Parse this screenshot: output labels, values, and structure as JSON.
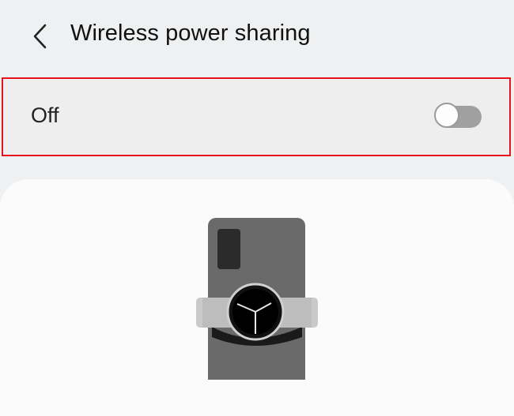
{
  "header": {
    "title": "Wireless power sharing",
    "back_icon": "chevron-left-icon"
  },
  "toggle": {
    "label": "Off",
    "state": "off"
  },
  "illustration": {
    "name": "phone-with-watch-illustration"
  },
  "colors": {
    "background": "#eef0f1",
    "highlight_border": "#e8141b",
    "track_off": "#a0a0a0"
  }
}
